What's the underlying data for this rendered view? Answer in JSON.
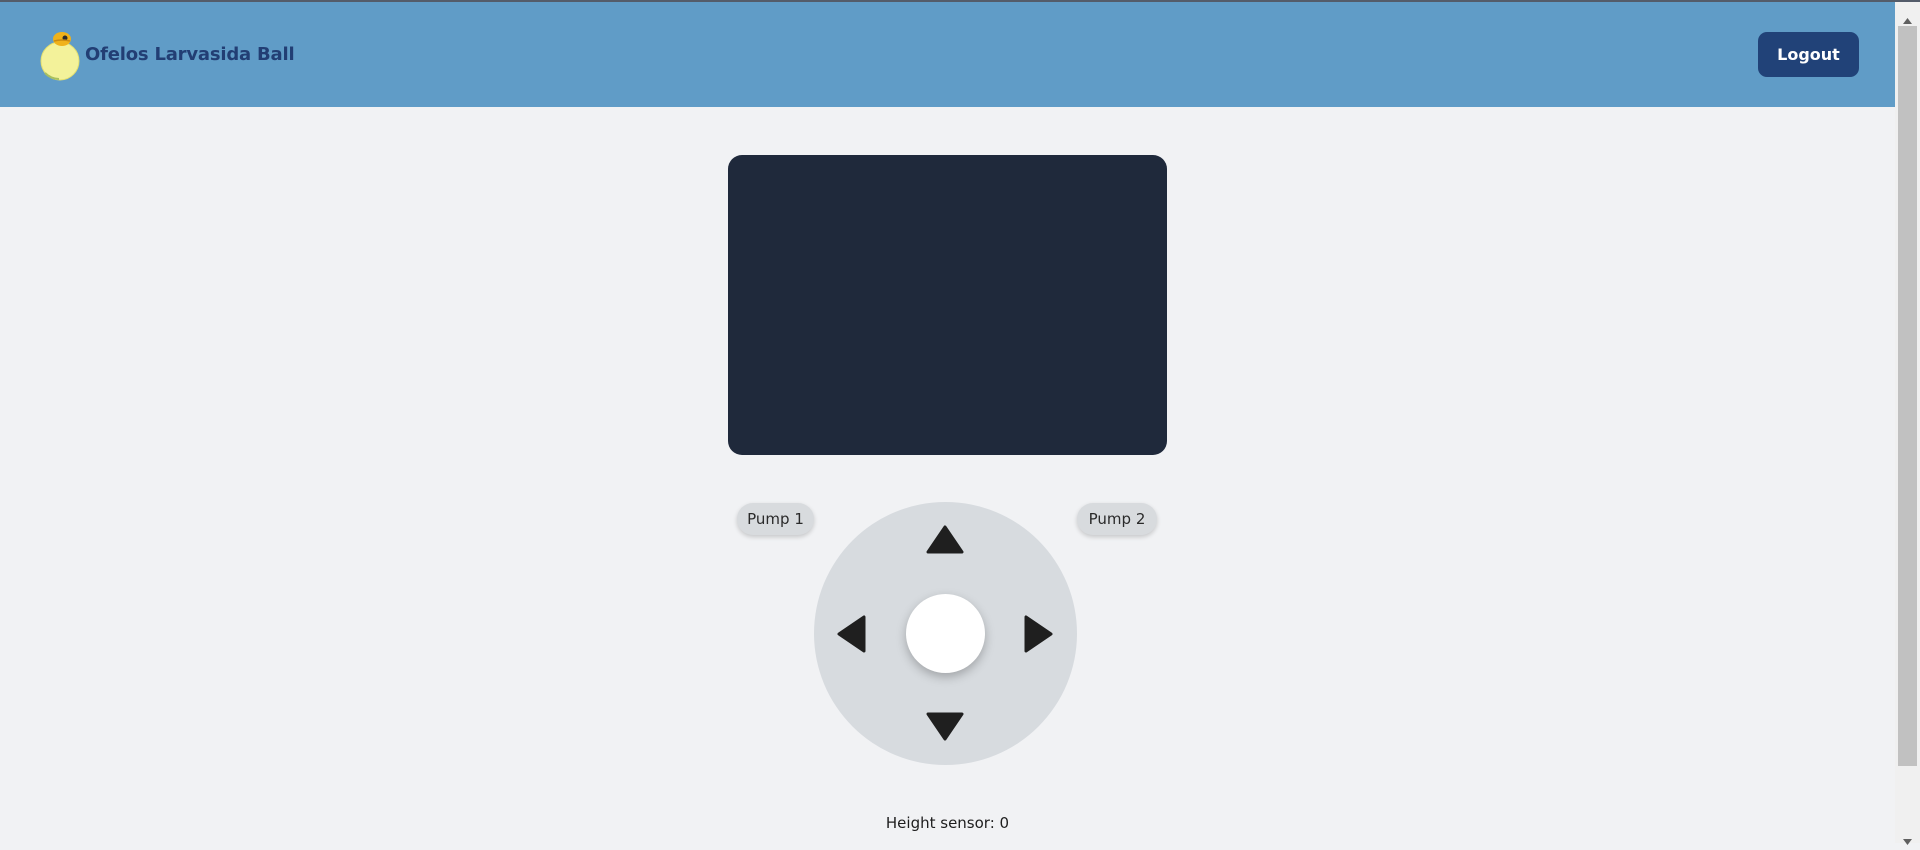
{
  "header": {
    "brand": "Ofelos Larvasida Ball",
    "logo_icon": "ball-mascot-icon",
    "logout_label": "Logout"
  },
  "controls": {
    "pump1_label": "Pump 1",
    "pump2_label": "Pump 2",
    "dpad_icons": [
      "arrow-up-icon",
      "arrow-down-icon",
      "arrow-left-icon",
      "arrow-right-icon"
    ]
  },
  "status": {
    "height_sensor": "Height sensor: 0"
  },
  "colors": {
    "header_bg": "#609cc7",
    "brand_text": "#223e74",
    "logout_bg": "#214278",
    "video_bg": "#1f293b",
    "page_bg": "#f1f2f4",
    "dpad_bg": "#d7dbdf"
  }
}
